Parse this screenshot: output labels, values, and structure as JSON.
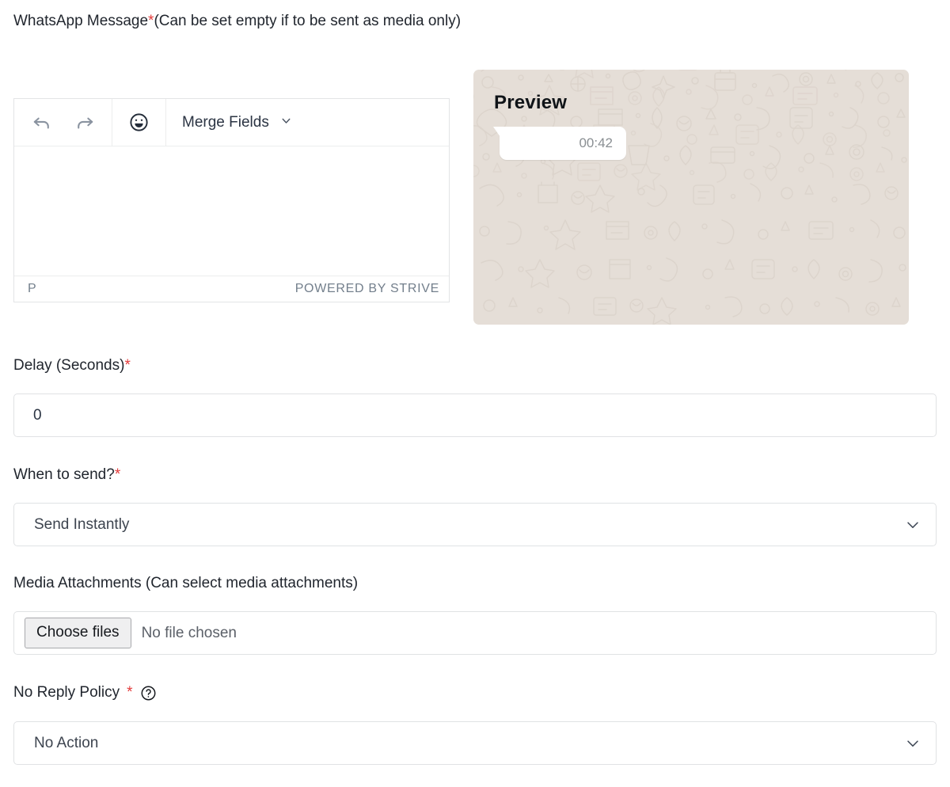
{
  "message_field": {
    "label": "WhatsApp Message",
    "required_mark": "*",
    "hint": "(Can be set empty if to be sent as media only)"
  },
  "editor": {
    "toolbar": {
      "undo_icon": "undo-arrow-icon",
      "redo_icon": "redo-arrow-icon",
      "emoji_icon": "emoji-smiley-icon",
      "merge_fields_label": "Merge Fields",
      "merge_fields_chevron": "chevron-down-icon"
    },
    "content": "",
    "status_left": "P",
    "status_right": "POWERED BY STRIVE"
  },
  "preview": {
    "title": "Preview",
    "bubble_text": "",
    "bubble_time": "00:42",
    "background_color": "#e5ded7",
    "bubble_color": "#ffffff"
  },
  "delay_field": {
    "label": "Delay (Seconds)",
    "required_mark": "*",
    "value": "0"
  },
  "when_to_send_field": {
    "label": "When to send?",
    "required_mark": "*",
    "value": "Send Instantly",
    "chevron": "chevron-down-icon"
  },
  "media_field": {
    "label": "Media Attachments (Can select media attachments)",
    "button_label": "Choose files",
    "file_status": "No file chosen"
  },
  "no_reply_policy_field": {
    "label": "No Reply Policy",
    "required_mark": "*",
    "help_icon": "question-mark-circle-icon",
    "value": "No Action",
    "chevron": "chevron-down-icon"
  },
  "colors": {
    "required_asterisk": "#e33b3b",
    "border": "#e0e2e4",
    "text": "#21262e",
    "muted_text": "#737f8c"
  }
}
